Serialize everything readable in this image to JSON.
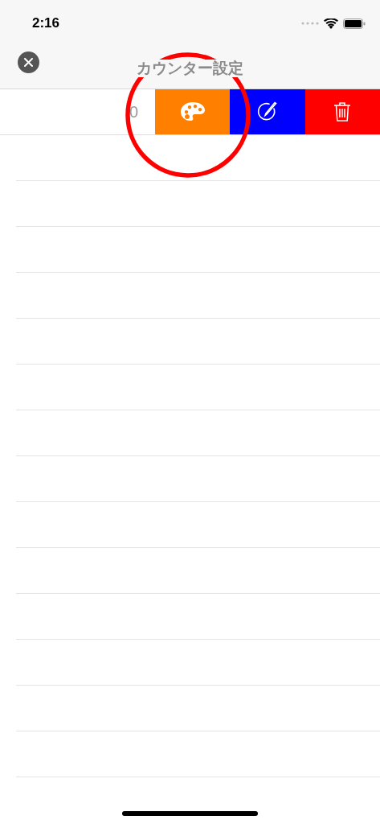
{
  "status_bar": {
    "time": "2:16"
  },
  "nav_bar": {
    "title": "カウンター設定"
  },
  "swiped_row": {
    "value": "0",
    "actions": [
      {
        "kind": "palette",
        "color": "#ff8000"
      },
      {
        "kind": "edit",
        "color": "#0000ff"
      },
      {
        "kind": "delete",
        "color": "#ff0000"
      }
    ]
  }
}
